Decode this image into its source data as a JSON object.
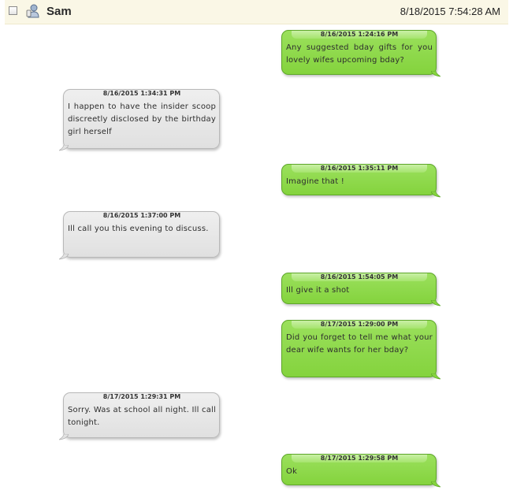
{
  "header": {
    "contact_name": "Sam",
    "timestamp": "8/18/2015 7:54:28 AM",
    "icon": "contact-icon"
  },
  "colors": {
    "sent_bubble": "#8fd94b",
    "received_bubble": "#e6e6e6",
    "header_background": "#faf7e6"
  },
  "messages": [
    {
      "direction": "sent",
      "time": "8/16/2015 1:24:16 PM",
      "text": "Any suggested bday gifts for you lovely wifes upcoming bday?"
    },
    {
      "direction": "received",
      "time": "8/16/2015 1:34:31 PM",
      "text": "I happen to have the insider scoop discreetly disclosed by the birthday girl herself"
    },
    {
      "direction": "sent",
      "time": "8/16/2015 1:35:11 PM",
      "text": "Imagine that !"
    },
    {
      "direction": "received",
      "time": "8/16/2015 1:37:00 PM",
      "text": "Ill call you this evening to discuss."
    },
    {
      "direction": "sent",
      "time": "8/16/2015 1:54:05 PM",
      "text": "Ill give it a shot"
    },
    {
      "direction": "sent",
      "time": "8/17/2015 1:29:00 PM",
      "text": "Did you forget to tell me what your dear wife wants for her bday?"
    },
    {
      "direction": "received",
      "time": "8/17/2015 1:29:31 PM",
      "text": "Sorry. Was at school all night. Ill call tonight."
    },
    {
      "direction": "sent",
      "time": "8/17/2015 1:29:58 PM",
      "text": "Ok"
    }
  ]
}
